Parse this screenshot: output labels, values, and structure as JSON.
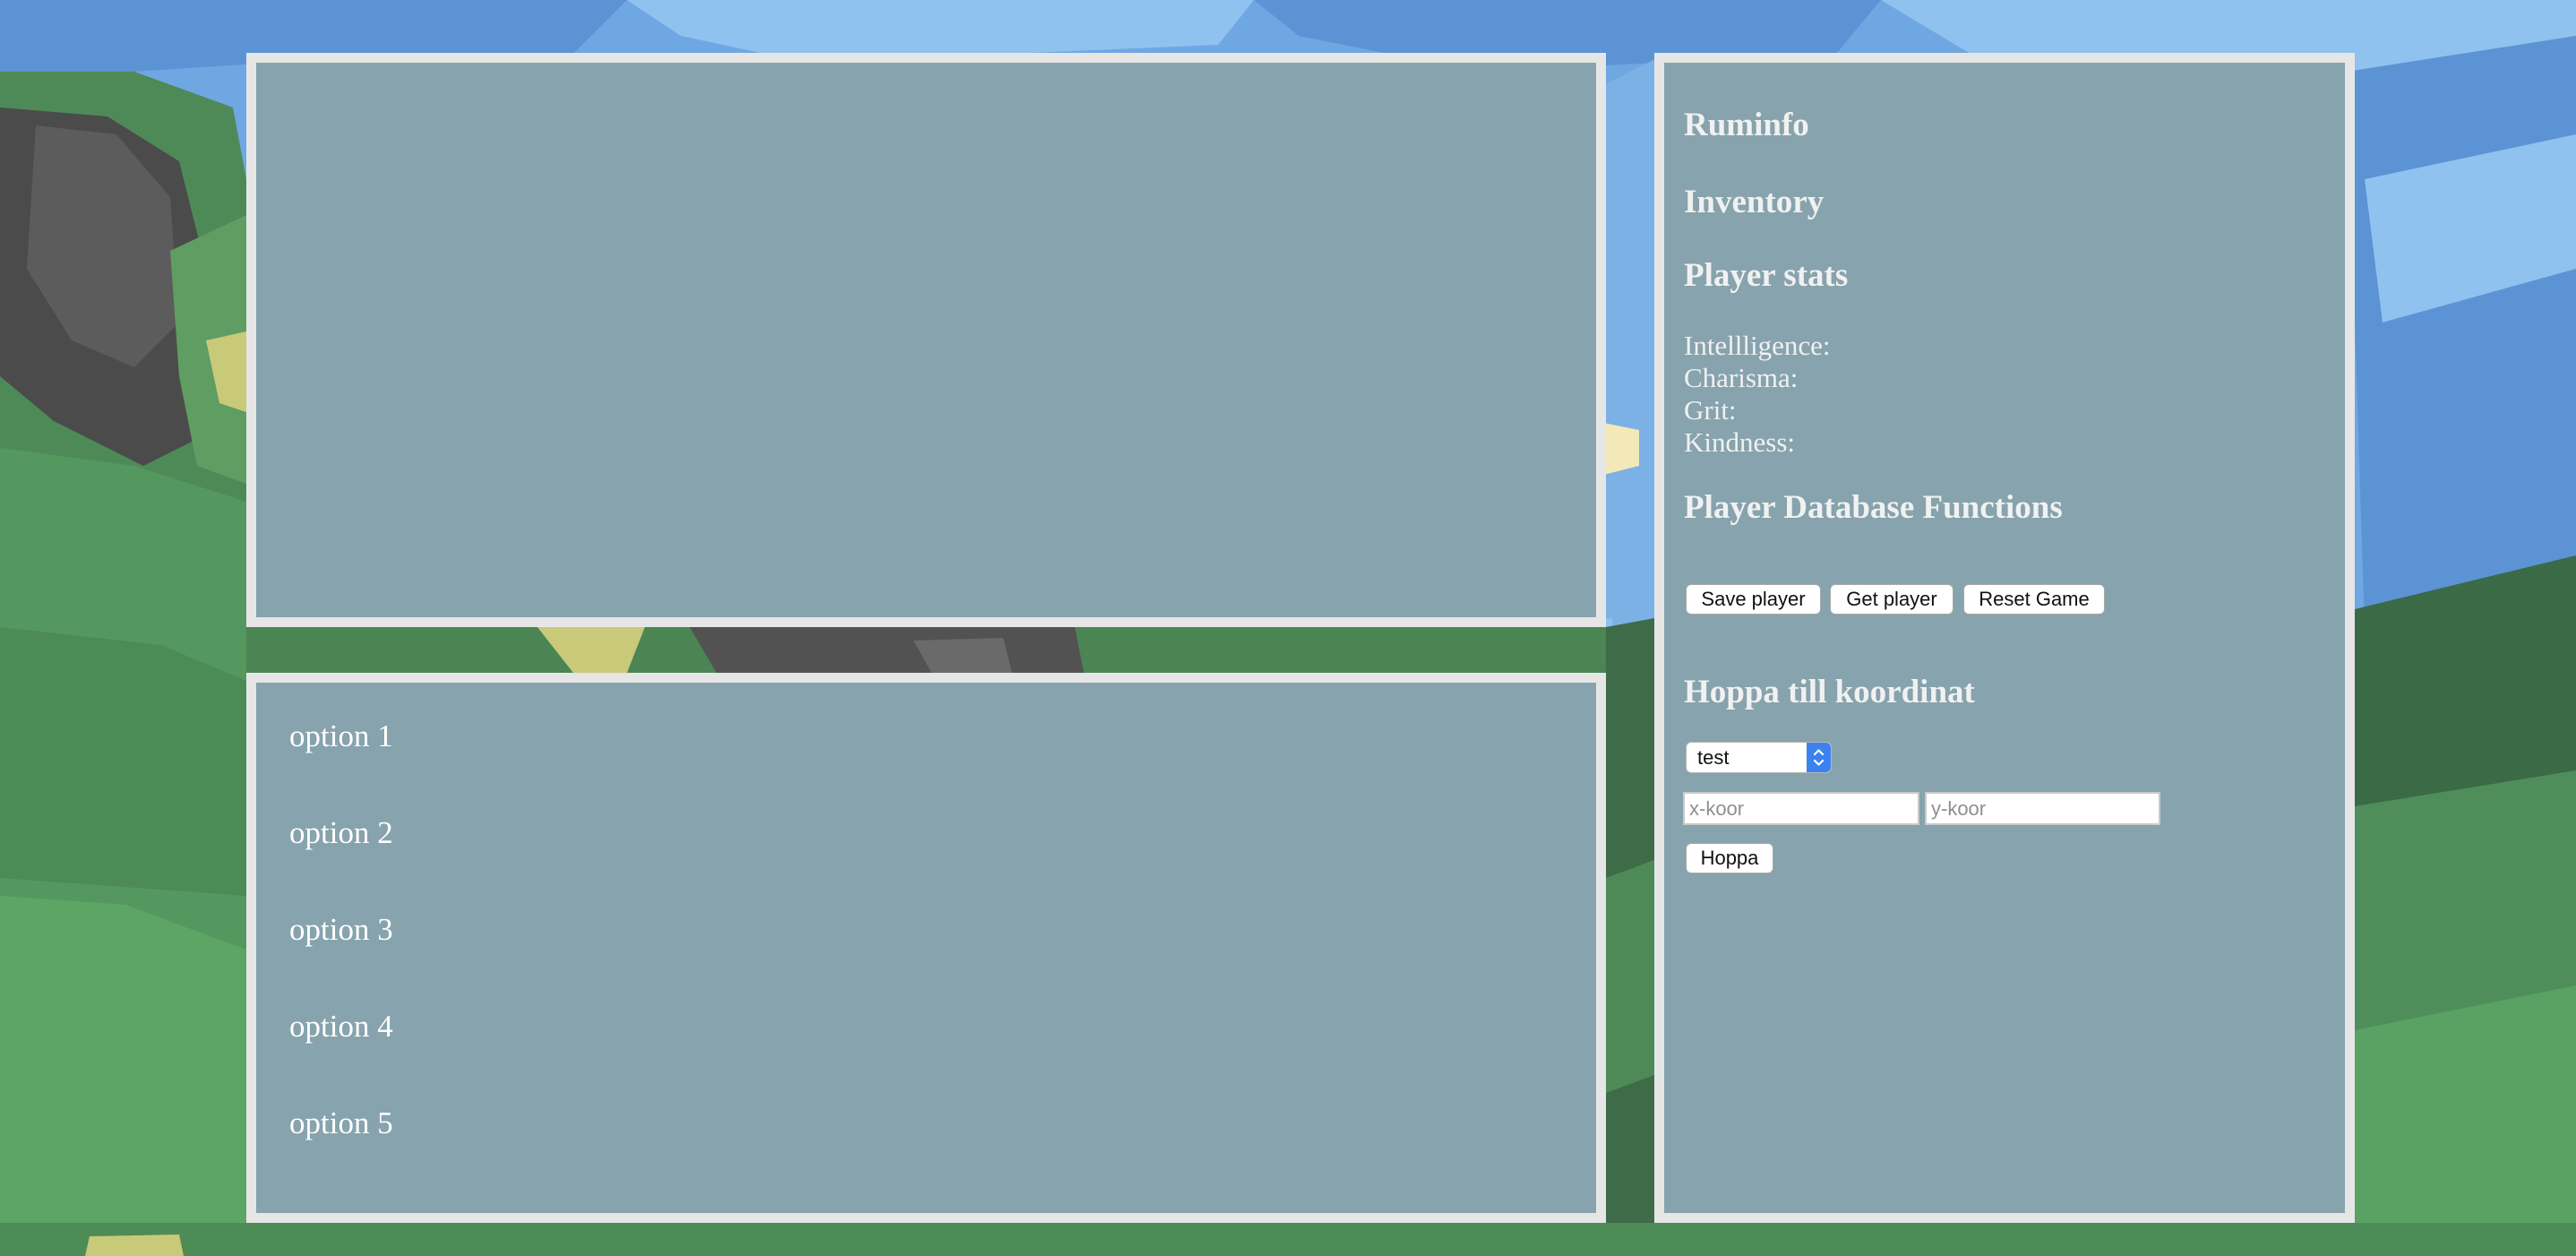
{
  "info": {
    "room_heading": "Ruminfo",
    "inventory_heading": "Inventory",
    "stats_heading": "Player stats",
    "stats": {
      "intelligence": "Intellligence:",
      "charisma": "Charisma:",
      "grit": "Grit:",
      "kindness": "Kindness:"
    },
    "database_heading": "Player Database Functions",
    "buttons": {
      "save": "Save player",
      "get": "Get player",
      "reset": "Reset Game"
    },
    "jump_heading": "Hoppa till koordinat",
    "location_select": "test",
    "x_placeholder": "x-koor",
    "y_placeholder": "y-koor",
    "hoppa": "Hoppa"
  },
  "options": [
    "option 1",
    "option 2",
    "option 3",
    "option 4",
    "option 5"
  ],
  "colors": {
    "panel_bg": "#87a3ad",
    "panel_border": "#e6e6e6",
    "panel_text": "#f1f1f1",
    "select_accent": "#3b82f0"
  }
}
